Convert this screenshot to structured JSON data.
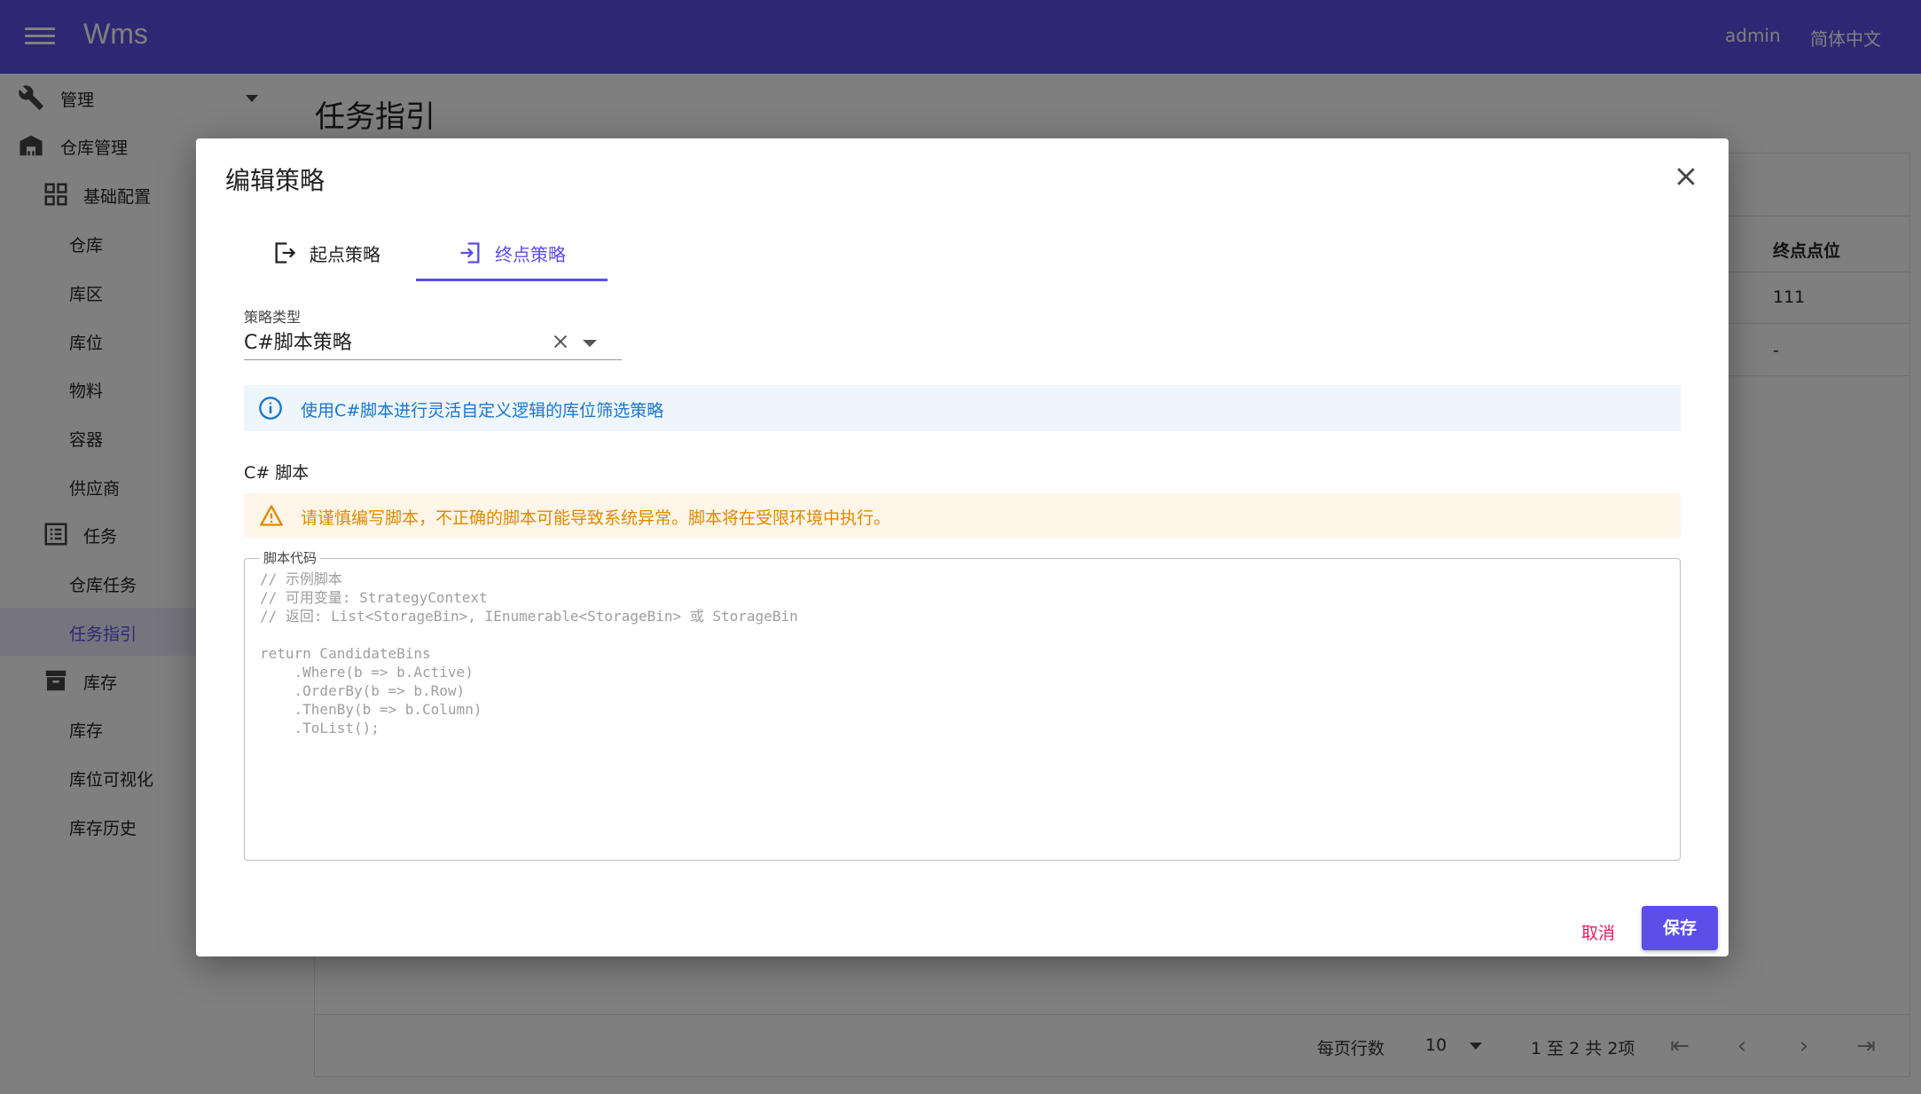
{
  "appbar": {
    "title": "Wms",
    "user": "admin",
    "language": "简体中文",
    "color": "#5c4ee8"
  },
  "sidebar": {
    "items": [
      {
        "label": "管理",
        "icon": "wrench-icon",
        "level": 1
      },
      {
        "label": "仓库管理",
        "icon": "warehouse-icon",
        "level": 1
      },
      {
        "label": "基础配置",
        "icon": "grid-icon",
        "level": 2
      },
      {
        "label": "仓库",
        "level": 3
      },
      {
        "label": "库区",
        "level": 3
      },
      {
        "label": "库位",
        "level": 3
      },
      {
        "label": "物料",
        "level": 3
      },
      {
        "label": "容器",
        "level": 3
      },
      {
        "label": "供应商",
        "level": 3
      },
      {
        "label": "任务",
        "icon": "list-icon",
        "level": 2
      },
      {
        "label": "仓库任务",
        "level": 3
      },
      {
        "label": "任务指引",
        "level": 3,
        "active": true
      },
      {
        "label": "库存",
        "icon": "archive-icon",
        "level": 2
      },
      {
        "label": "库存",
        "level": 3
      },
      {
        "label": "库位可视化",
        "level": 3
      },
      {
        "label": "库存历史",
        "level": 3
      }
    ]
  },
  "main": {
    "page_title": "任务指引",
    "table": {
      "visible_header": "终点点位",
      "rows": [
        "111",
        "-"
      ]
    },
    "footer": {
      "rows_per_page_label": "每页行数",
      "rows_per_page": "10",
      "range": "1 至 2 共 2项"
    }
  },
  "modal": {
    "title": "编辑策略",
    "tabs": [
      {
        "label": "起点策略",
        "icon": "login-icon",
        "active": false
      },
      {
        "label": "终点策略",
        "icon": "logout-icon",
        "active": true
      }
    ],
    "strategy_type_label": "策略类型",
    "strategy_type_value": "C#脚本策略",
    "info_text": "使用C#脚本进行灵活自定义逻辑的库位筛选策略",
    "section_title": "C# 脚本",
    "warning_text": "请谨慎编写脚本，不正确的脚本可能导致系统异常。脚本将在受限环境中执行。",
    "code_label": "脚本代码",
    "code_placeholder": "// 示例脚本\n// 可用变量: StrategyContext\n// 返回: List<StorageBin>, IEnumerable<StorageBin> 或 StorageBin\n\nreturn CandidateBins\n    .Where(b => b.Active)\n    .OrderBy(b => b.Row)\n    .ThenBy(b => b.Column)\n    .ToList();",
    "cancel_label": "取消",
    "save_label": "保存",
    "colors": {
      "primary": "#5c4ee8",
      "cancel": "#e91e63",
      "info": "#1976d2",
      "warning": "#e08a00"
    }
  }
}
